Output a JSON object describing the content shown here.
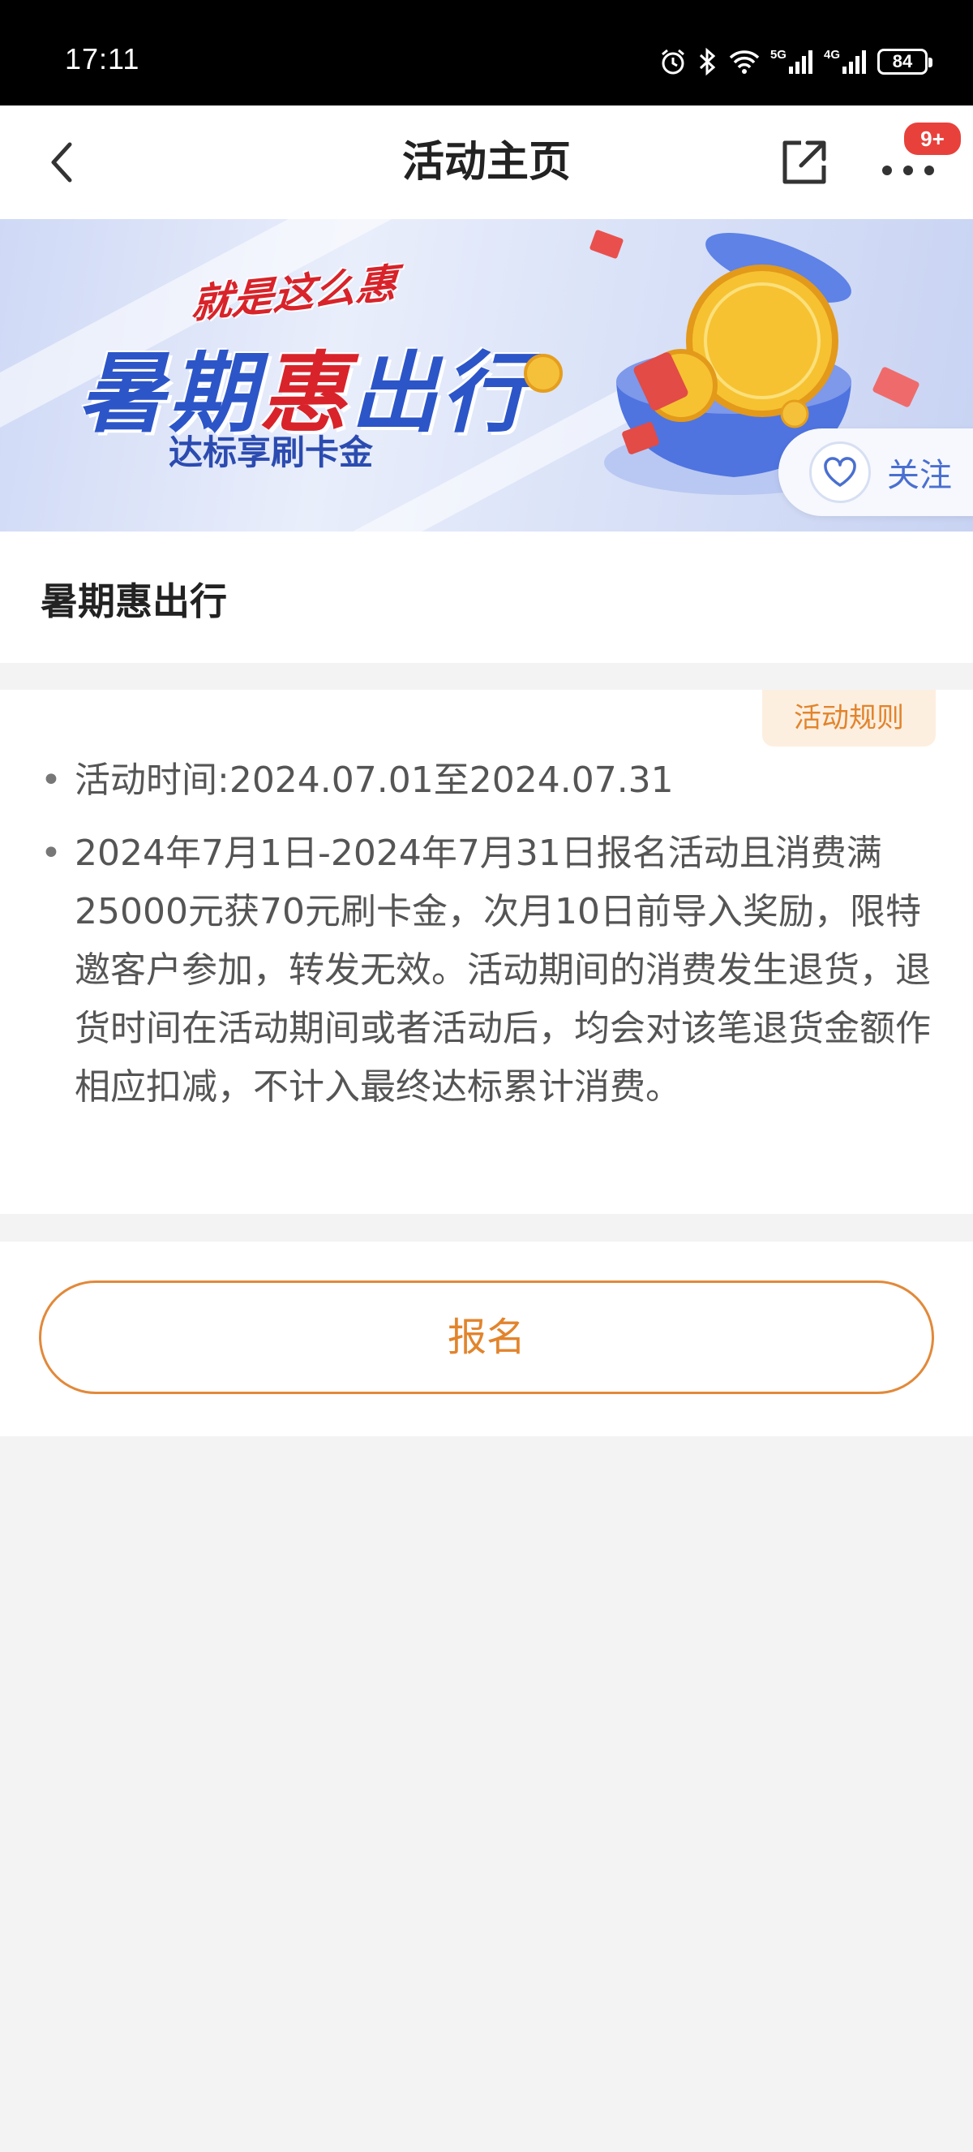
{
  "status_bar": {
    "time": "17:11",
    "network_1": "5G",
    "network_2": "4G",
    "battery": "84"
  },
  "nav": {
    "title": "活动主页",
    "badge": "9+"
  },
  "banner": {
    "tag": "就是这么惠",
    "title_part1": "暑期",
    "title_highlight": "惠",
    "title_part2": "出行",
    "subtitle": "达标享刷卡金",
    "follow_label": "关注",
    "accent_blue": "#2c55c8",
    "accent_red": "#d8232a"
  },
  "activity": {
    "name": "暑期惠出行"
  },
  "rules": {
    "button_label": "活动规则",
    "items": [
      {
        "bullet": "•",
        "text": "活动时间:2024.07.01至2024.07.31"
      },
      {
        "bullet": "•",
        "text": "2024年7月1日-2024年7月31日报名活动且消费满25000元获70元刷卡金，次月10日前导入奖励，限特邀客户参加，转发无效。活动期间的消费发生退货，退货时间在活动期间或者活动后，均会对该笔退货金额作相应扣减，不计入最终达标累计消费。"
      }
    ]
  },
  "register": {
    "label": "报名",
    "accent": "#e2842c"
  }
}
